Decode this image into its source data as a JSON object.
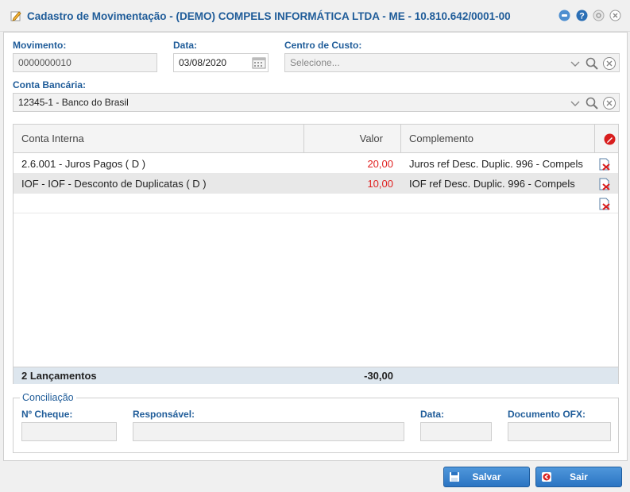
{
  "window": {
    "title": "Cadastro de Movimentação - (DEMO) COMPELS INFORMÁTICA LTDA - ME - 10.810.642/0001-00"
  },
  "form": {
    "movimento_label": "Movimento:",
    "movimento_value": "0000000010",
    "data_label": "Data:",
    "data_value": "03/08/2020",
    "centro_label": "Centro de Custo:",
    "centro_placeholder": "Selecione...",
    "conta_label": "Conta Bancária:",
    "conta_value": "12345-1 - Banco do Brasil"
  },
  "grid": {
    "columns": [
      "Conta Interna",
      "Valor",
      "Complemento"
    ],
    "rows": [
      {
        "conta": "2.6.001 - Juros Pagos ( D )",
        "valor": "20,00",
        "complemento": "Juros ref Desc. Duplic. 996 - Compels"
      },
      {
        "conta": "IOF - IOF - Desconto de Duplicatas ( D )",
        "valor": "10,00",
        "complemento": "IOF ref Desc. Duplic. 996 - Compels"
      }
    ],
    "footer_count": "2 Lançamentos",
    "footer_total": "-30,00"
  },
  "conciliacao": {
    "legend": "Conciliação",
    "cheque_label": "Nº Cheque:",
    "responsavel_label": "Responsável:",
    "data_label": "Data:",
    "ofx_label": "Documento OFX:"
  },
  "buttons": {
    "salvar": "Salvar",
    "sair": "Sair"
  },
  "colors": {
    "accent": "#1f5c99",
    "negative": "#e02020",
    "button": "#2b74c2"
  }
}
